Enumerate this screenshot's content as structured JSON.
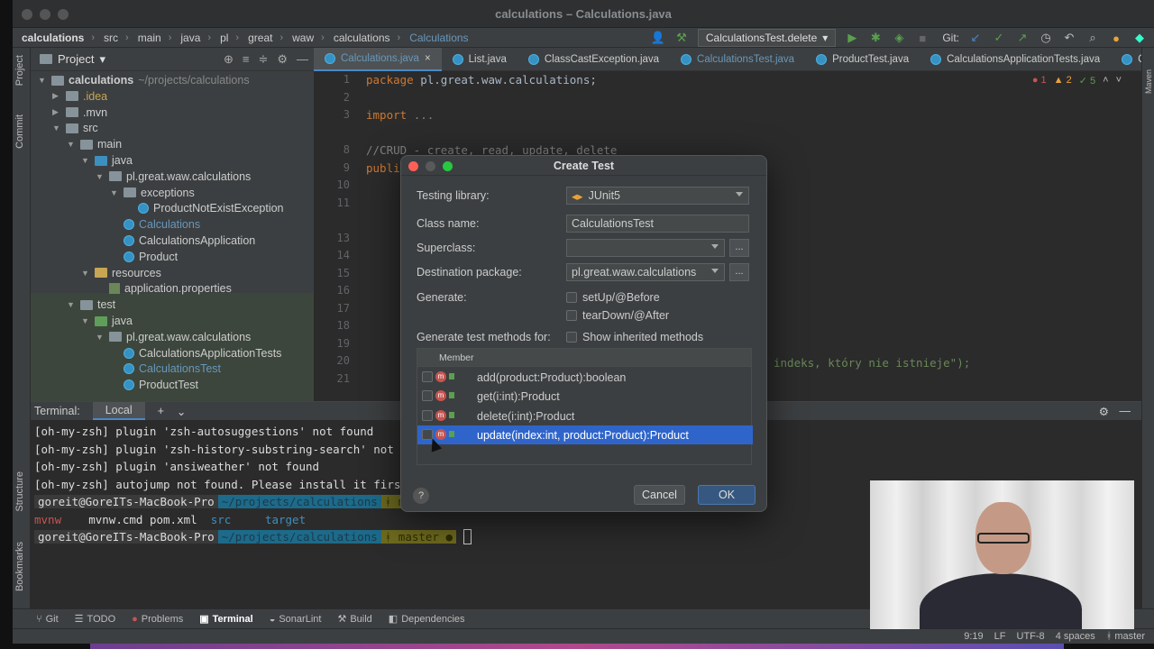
{
  "window": {
    "title": "calculations – Calculations.java"
  },
  "breadcrumbs": [
    "calculations",
    "src",
    "main",
    "java",
    "pl",
    "great",
    "waw",
    "calculations",
    "Calculations"
  ],
  "run_config": "CalculationsTest.delete",
  "git_label": "Git:",
  "project_panel": {
    "title": "Project",
    "tree": [
      {
        "label": "calculations",
        "suffix": "~/projects/calculations",
        "depth": 0,
        "icon": "folder"
      },
      {
        "label": ".idea",
        "depth": 1,
        "icon": "folder"
      },
      {
        "label": ".mvn",
        "depth": 1,
        "icon": "folder"
      },
      {
        "label": "src",
        "depth": 1,
        "icon": "folder"
      },
      {
        "label": "main",
        "depth": 2,
        "icon": "folder"
      },
      {
        "label": "java",
        "depth": 3,
        "icon": "folder-blue"
      },
      {
        "label": "pl.great.waw.calculations",
        "depth": 4,
        "icon": "package"
      },
      {
        "label": "exceptions",
        "depth": 5,
        "icon": "package"
      },
      {
        "label": "ProductNotExistException",
        "depth": 6,
        "icon": "class"
      },
      {
        "label": "Calculations",
        "depth": 5,
        "icon": "class"
      },
      {
        "label": "CalculationsApplication",
        "depth": 5,
        "icon": "class"
      },
      {
        "label": "Product",
        "depth": 5,
        "icon": "class"
      },
      {
        "label": "resources",
        "depth": 3,
        "icon": "folder-orange"
      },
      {
        "label": "application.properties",
        "depth": 4,
        "icon": "props"
      },
      {
        "label": "test",
        "depth": 2,
        "icon": "folder"
      },
      {
        "label": "java",
        "depth": 3,
        "icon": "folder-green"
      },
      {
        "label": "pl.great.waw.calculations",
        "depth": 4,
        "icon": "package"
      },
      {
        "label": "CalculationsApplicationTests",
        "depth": 5,
        "icon": "class"
      },
      {
        "label": "CalculationsTest",
        "depth": 5,
        "icon": "class"
      },
      {
        "label": "ProductTest",
        "depth": 5,
        "icon": "class"
      }
    ]
  },
  "editor_tabs": [
    "Calculations.java",
    "List.java",
    "ClassCastException.java",
    "CalculationsTest.java",
    "ProductTest.java",
    "CalculationsApplicationTests.java",
    "Ca"
  ],
  "inspections": {
    "errors": "1",
    "warnings": "2",
    "checks": "5"
  },
  "code": {
    "line_numbers": [
      "1",
      "2",
      "3",
      "",
      "8",
      "9",
      "10",
      "11",
      "",
      "13",
      "14",
      "15",
      "16",
      "17",
      "18",
      "19",
      "20",
      "21"
    ],
    "package_kw": "package",
    "package_name": "pl.great.waw.calculations;",
    "import_kw": "import",
    "import_dots": "...",
    "comment": "//CRUD - create, read, update, delete",
    "public_kw": "public",
    "string_tail": "indeks, który nie istnieje\");"
  },
  "terminal": {
    "tab_label": "Terminal:",
    "local_label": "Local",
    "lines": [
      "[oh-my-zsh] plugin 'zsh-autosuggestions' not found",
      "[oh-my-zsh] plugin 'zsh-history-substring-search' not found",
      "[oh-my-zsh] plugin 'ansiweather' not found",
      "[oh-my-zsh] autojump not found. Please install it first."
    ],
    "prompt_user": "goreit@GoreITs-MacBook-Pro",
    "prompt_path": "~/projects/calculations",
    "prompt_git": "master",
    "ls_output": [
      "mvnw",
      "mvnw.cmd",
      "pom.xml",
      "src",
      "target"
    ]
  },
  "bottom_tools": [
    "Git",
    "TODO",
    "Problems",
    "Terminal",
    "SonarLint",
    "Build",
    "Dependencies"
  ],
  "status": {
    "position": "9:19",
    "line_sep": "LF",
    "encoding": "UTF-8",
    "indent": "4 spaces",
    "branch": "master"
  },
  "left_strip_labels": [
    "Project",
    "Commit",
    "Structure",
    "Bookmarks"
  ],
  "dialog": {
    "title": "Create Test",
    "testing_library_label": "Testing library:",
    "testing_library_value": "JUnit5",
    "class_name_label": "Class name:",
    "class_name_value": "CalculationsTest",
    "superclass_label": "Superclass:",
    "superclass_value": "",
    "destination_label": "Destination package:",
    "destination_value": "pl.great.waw.calculations",
    "generate_label": "Generate:",
    "setup_label": "setUp/@Before",
    "teardown_label": "tearDown/@After",
    "methods_label": "Generate test methods for:",
    "inherited_label": "Show inherited methods",
    "member_header": "Member",
    "members": [
      {
        "text": "add(product:Product):boolean",
        "selected": false
      },
      {
        "text": "get(i:int):Product",
        "selected": false
      },
      {
        "text": "delete(i:int):Product",
        "selected": false
      },
      {
        "text": "update(index:int, product:Product):Product",
        "selected": true
      }
    ],
    "browse": "...",
    "help": "?",
    "cancel": "Cancel",
    "ok": "OK"
  }
}
